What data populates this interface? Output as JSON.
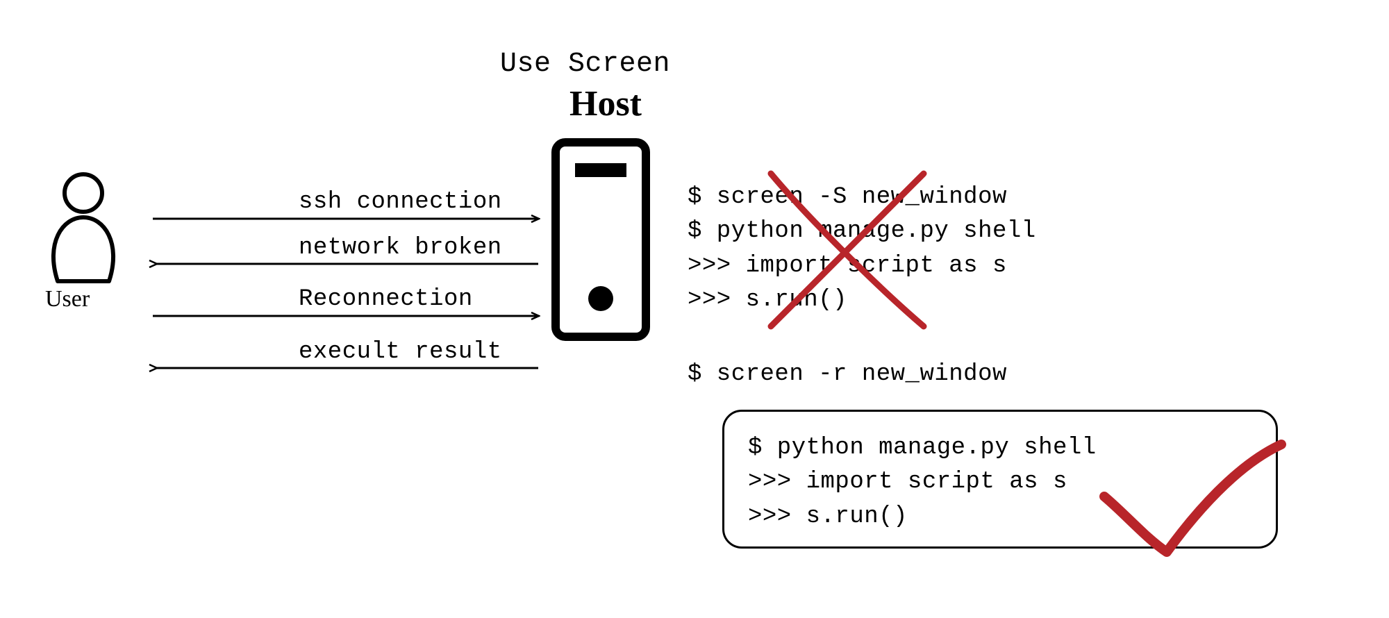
{
  "title": "Use Screen",
  "user_label": "User",
  "host_label": "Host",
  "arrows": {
    "a1": "ssh connection",
    "a2": "network broken",
    "a3": "Reconnection",
    "a4": "execult result"
  },
  "code_top": {
    "l1": "$ screen -S new_window",
    "l2": "$ python manage.py shell",
    "l3": ">>> import script as s",
    "l4": ">>> s.run()"
  },
  "code_reattach": "$ screen -r new_window",
  "code_box": {
    "l1": "$ python manage.py shell",
    "l2": ">>> import script as s",
    "l3": ">>> s.run()"
  },
  "colors": {
    "mark": "#b8252a",
    "stroke": "#000000"
  }
}
